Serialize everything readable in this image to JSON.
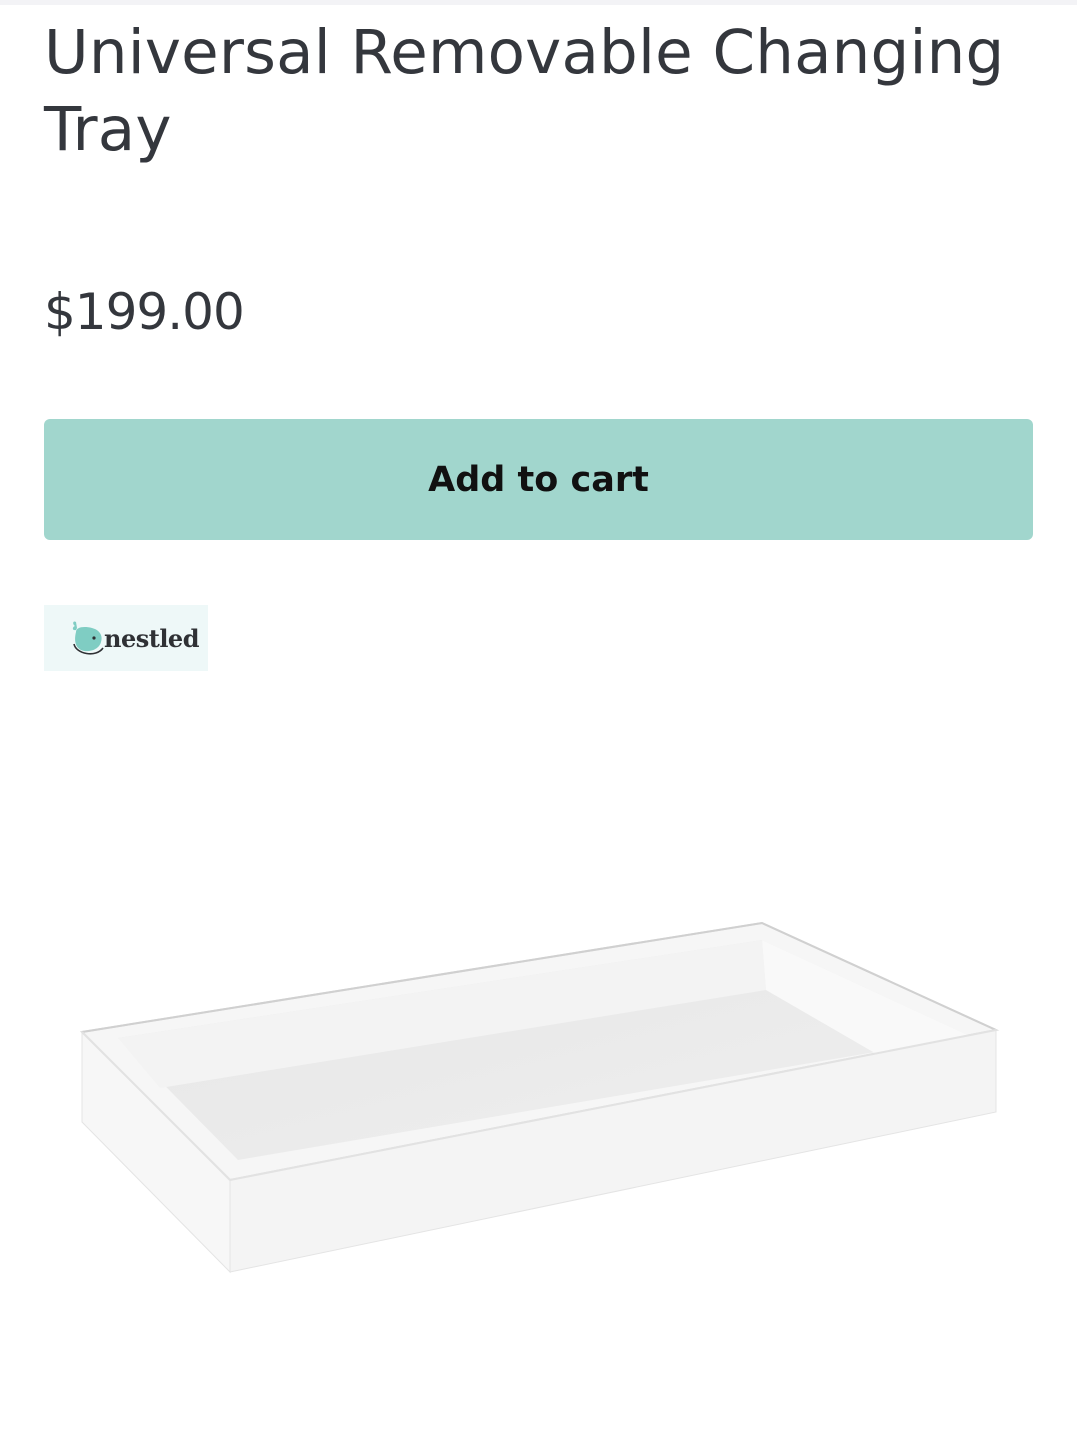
{
  "product": {
    "title": "Universal Removable Changing Tray",
    "price": "$199.00"
  },
  "cart": {
    "add_label": "Add to cart"
  },
  "brand": {
    "name": "nestled"
  },
  "colors": {
    "accent": "#a1d6cd",
    "brand_bg": "#eef8f8",
    "brand_logo": "#7fcdc3",
    "text": "#34373d"
  },
  "icons": {
    "brand_logo": "whale-icon"
  }
}
